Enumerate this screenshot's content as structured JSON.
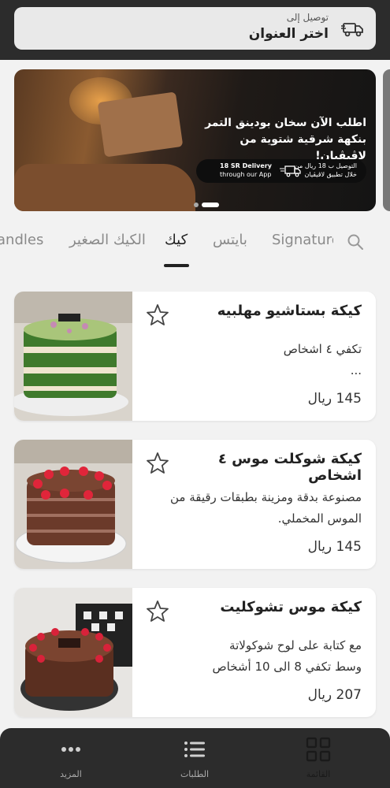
{
  "header": {
    "delivery_to": "توصيل إلى",
    "address": "اختر العنوان"
  },
  "banner": {
    "headline": "اطلب الآن سخان بودينق التمر بنكهة شرقية شتوية من لاڤيڤيان!",
    "pill_ar_line1": "التوصيل ب 18 ريال من",
    "pill_ar_line2": "خلال تطبيق لاڤيڤيان",
    "pill_en_line1": "18 SR Delivery",
    "pill_en_line2": "through our App",
    "slides": 2,
    "active_slide": 2
  },
  "tabs": [
    {
      "label": "andles"
    },
    {
      "label": "الكيك الصغير"
    },
    {
      "label": "كيك"
    },
    {
      "label": "بايتس"
    },
    {
      "label": "Signature"
    }
  ],
  "active_tab": "كيك",
  "products": [
    {
      "title": "كيكة بستاشيو مهلبيه",
      "desc_line1": "تكفي ٤ اشخاص",
      "desc_line2": "...",
      "price": "145 ريال"
    },
    {
      "title": "كيكة شوكلت موس ٤ اشخاص",
      "desc_line1": "مصنوعة بدقة ومزينة بطبقات رقيقة من",
      "desc_line2": "الموس المخملي.",
      "price": "145 ريال"
    },
    {
      "title": "كيكة موس تشوكليت",
      "desc_line1": "مع كتابة على لوح شوكولاتة",
      "desc_line2": "وسط تكفي 8 الى 10 أشخاص",
      "price": "207 ريال"
    }
  ],
  "bottom_nav": {
    "more": "المزيد",
    "orders": "الطلبات",
    "menu": "القائمة"
  },
  "colors": {
    "dark_bar": "#2c2c2c",
    "background": "#f2f2f2",
    "card": "#ffffff"
  }
}
